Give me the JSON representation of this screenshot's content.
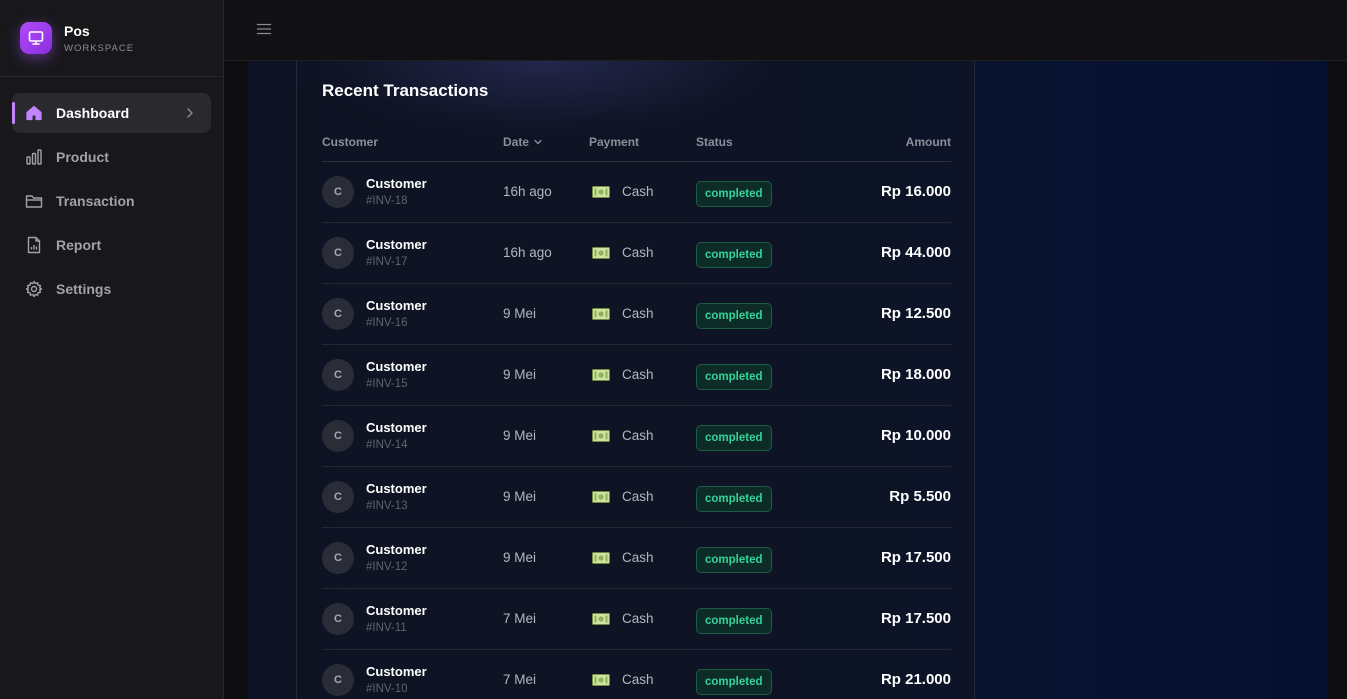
{
  "brand": {
    "name": "Pos",
    "subtitle": "WORKSPACE",
    "logo_icon": "monitor-icon",
    "accent": "#a855f7"
  },
  "nav": {
    "items": [
      {
        "label": "Dashboard",
        "icon": "home-icon",
        "active": true
      },
      {
        "label": "Product",
        "icon": "bar-chart-icon"
      },
      {
        "label": "Transaction",
        "icon": "folder-icon"
      },
      {
        "label": "Report",
        "icon": "file-chart-icon"
      },
      {
        "label": "Settings",
        "icon": "gear-icon"
      }
    ]
  },
  "topbar": {
    "menu_icon": "menu-icon"
  },
  "transactions": {
    "title": "Recent Transactions",
    "columns": {
      "customer": "Customer",
      "date": "Date",
      "payment": "Payment",
      "status": "Status",
      "amount": "Amount"
    },
    "rows": [
      {
        "initial": "C",
        "name": "Customer",
        "invoice": "#INV-18",
        "date": "16h ago",
        "payment": "Cash",
        "status": "completed",
        "amount": "Rp 16.000"
      },
      {
        "initial": "C",
        "name": "Customer",
        "invoice": "#INV-17",
        "date": "16h ago",
        "payment": "Cash",
        "status": "completed",
        "amount": "Rp 44.000"
      },
      {
        "initial": "C",
        "name": "Customer",
        "invoice": "#INV-16",
        "date": "9 Mei",
        "payment": "Cash",
        "status": "completed",
        "amount": "Rp 12.500"
      },
      {
        "initial": "C",
        "name": "Customer",
        "invoice": "#INV-15",
        "date": "9 Mei",
        "payment": "Cash",
        "status": "completed",
        "amount": "Rp 18.000"
      },
      {
        "initial": "C",
        "name": "Customer",
        "invoice": "#INV-14",
        "date": "9 Mei",
        "payment": "Cash",
        "status": "completed",
        "amount": "Rp 10.000"
      },
      {
        "initial": "C",
        "name": "Customer",
        "invoice": "#INV-13",
        "date": "9 Mei",
        "payment": "Cash",
        "status": "completed",
        "amount": "Rp 5.500"
      },
      {
        "initial": "C",
        "name": "Customer",
        "invoice": "#INV-12",
        "date": "9 Mei",
        "payment": "Cash",
        "status": "completed",
        "amount": "Rp 17.500"
      },
      {
        "initial": "C",
        "name": "Customer",
        "invoice": "#INV-11",
        "date": "7 Mei",
        "payment": "Cash",
        "status": "completed",
        "amount": "Rp 17.500"
      },
      {
        "initial": "C",
        "name": "Customer",
        "invoice": "#INV-10",
        "date": "7 Mei",
        "payment": "Cash",
        "status": "completed",
        "amount": "Rp 21.000"
      }
    ]
  }
}
